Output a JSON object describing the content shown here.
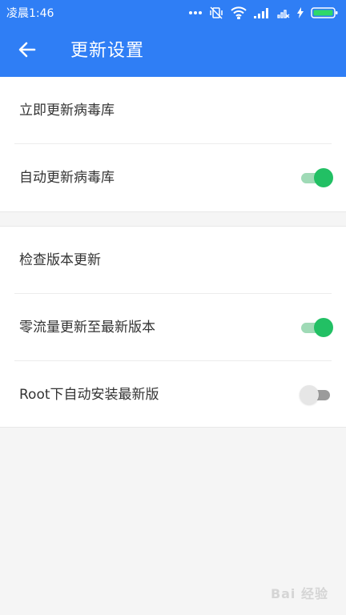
{
  "status_bar": {
    "time": "凌晨1:46",
    "icons": [
      "more-dots-icon",
      "vibrate-off-icon",
      "wifi-icon",
      "signal-icon",
      "no-sim-signal-icon",
      "charging-icon",
      "battery-icon"
    ]
  },
  "app_bar": {
    "back_icon": "arrow-left-icon",
    "title": "更新设置"
  },
  "settings": {
    "update_now": "立即更新病毒库",
    "auto_update": {
      "label": "自动更新病毒库",
      "enabled": true
    },
    "check_version": "检查版本更新",
    "zero_data_update": {
      "label": "零流量更新至最新版本",
      "enabled": true
    },
    "root_auto_install": {
      "label": "Root下自动安装最新版",
      "enabled": false
    }
  },
  "colors": {
    "header": "#2f7ef5",
    "switch_on_thumb": "#22c064",
    "switch_on_track": "#9fdab6",
    "switch_off_thumb": "#e6e6e6",
    "switch_off_track": "#9b9b9b"
  },
  "watermark": "Bai 经验"
}
